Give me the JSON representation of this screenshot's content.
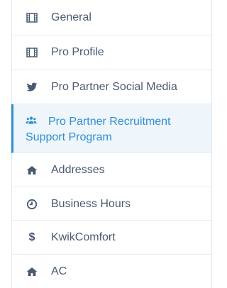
{
  "nav": {
    "items": [
      {
        "label": "General",
        "icon": "film-icon"
      },
      {
        "label": "Pro Profile",
        "icon": "film-icon"
      },
      {
        "label": "Pro Partner Social Media",
        "icon": "twitter-icon"
      },
      {
        "label": "Pro Partner Recruitment Support Program",
        "icon": "users-icon",
        "active": true
      },
      {
        "label": "Addresses",
        "icon": "home-icon"
      },
      {
        "label": "Business Hours",
        "icon": "clock-icon"
      },
      {
        "label": "KwikComfort",
        "icon": "dollar-icon"
      },
      {
        "label": "AC",
        "icon": "home-icon"
      }
    ]
  },
  "colors": {
    "text": "#4a5a72",
    "active_text": "#2f8fcf",
    "active_bg": "#eef5fb",
    "border": "#e9ecef"
  }
}
